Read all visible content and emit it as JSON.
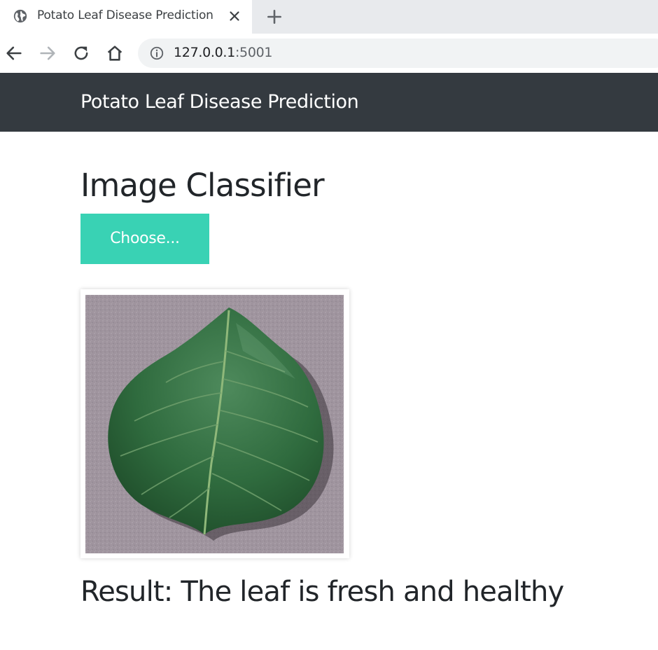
{
  "browser": {
    "tab": {
      "title": "Potato Leaf Disease Prediction",
      "favicon": "globe-icon"
    },
    "new_tab_icon": "plus-icon",
    "toolbar": {
      "back_icon": "arrow-left-icon",
      "forward_icon": "arrow-right-icon",
      "reload_icon": "reload-icon",
      "home_icon": "home-icon"
    },
    "address": {
      "host": "127.0.0.1",
      "port": ":5001",
      "info_icon": "info-icon"
    }
  },
  "page": {
    "navbar": {
      "brand": "Potato Leaf Disease Prediction",
      "background": "#343a40"
    },
    "title": "Image Classifier",
    "choose_button": {
      "label": "Choose...",
      "color": "#39d2b4"
    },
    "preview_image": {
      "subject": "green potato leaf on grey background"
    },
    "result": "Result: The leaf is fresh and healthy"
  }
}
